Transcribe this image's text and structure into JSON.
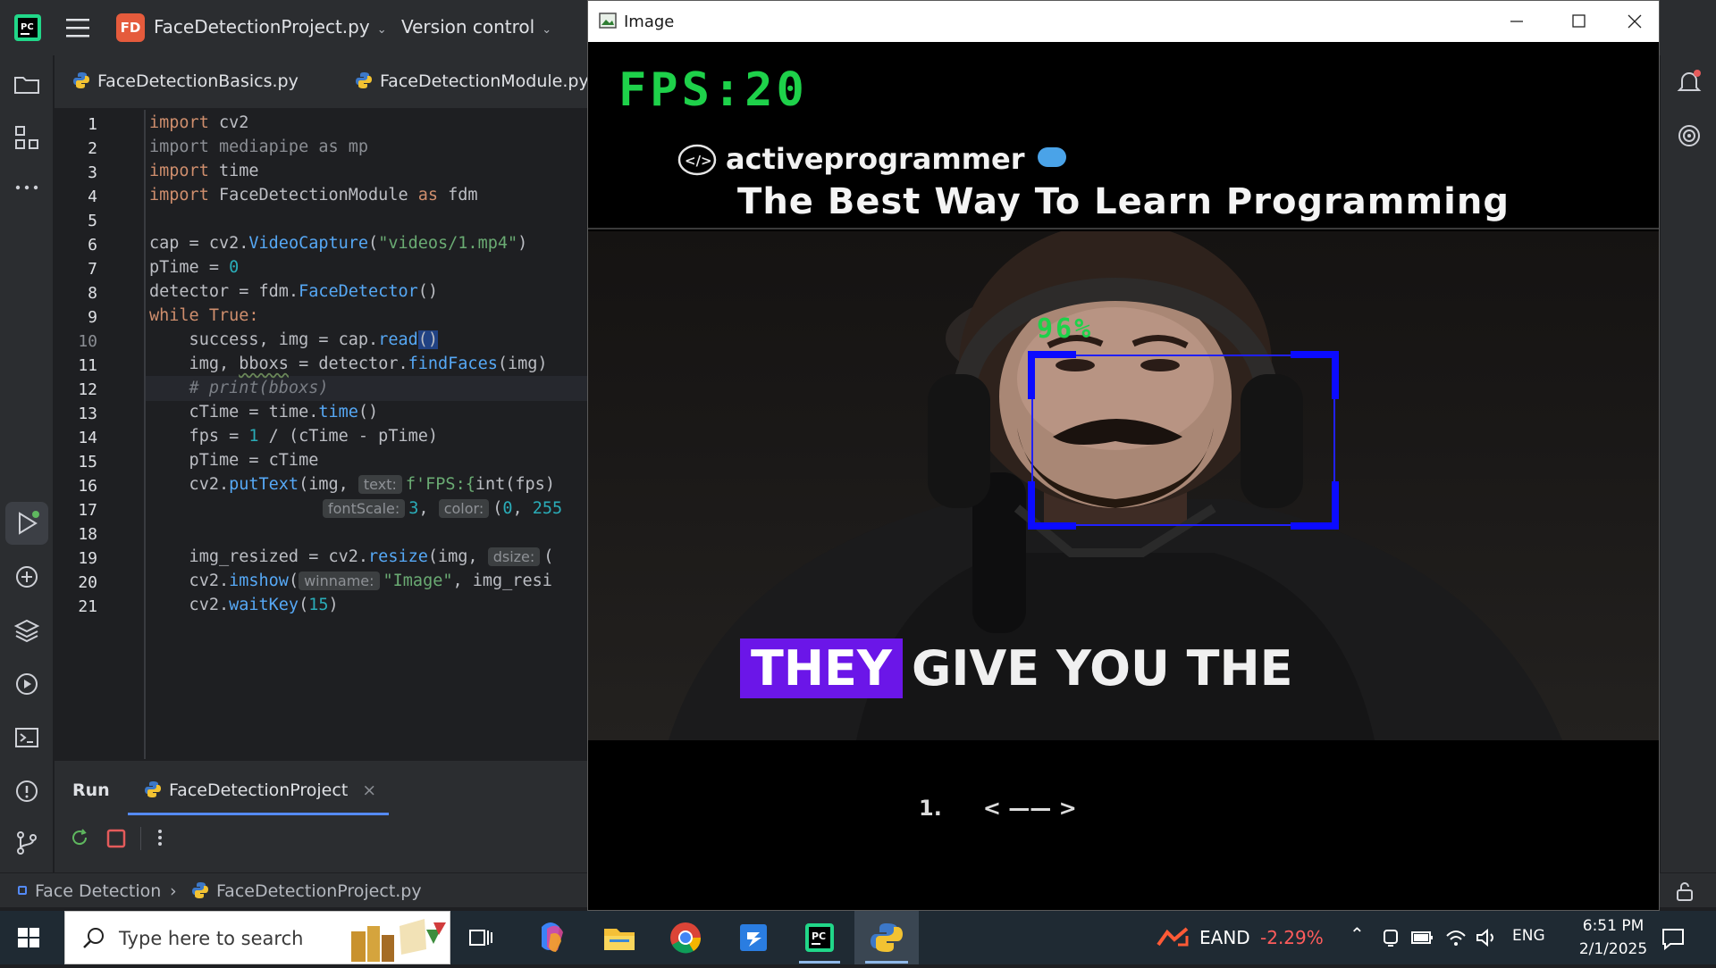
{
  "ide": {
    "project_badge": "FD",
    "project_name": "FaceDetectionProject.py",
    "vcs_label": "Version control",
    "tabs": [
      {
        "label": "FaceDetectionBasics.py"
      },
      {
        "label": "FaceDetectionModule.py"
      }
    ],
    "line_numbers": [
      "1",
      "2",
      "3",
      "4",
      "5",
      "6",
      "7",
      "8",
      "9",
      "10",
      "11",
      "12",
      "13",
      "14",
      "15",
      "16",
      "17",
      "18",
      "19",
      "20",
      "21"
    ],
    "code": {
      "l1a": "import",
      "l1b": " cv2",
      "l2": "import mediapipe as mp",
      "l3a": "import",
      "l3b": " time",
      "l4a": "import",
      "l4b": " FaceDetectionModule ",
      "l4c": "as",
      "l4d": " fdm",
      "l6a": "cap = cv2.",
      "l6b": "VideoCapture",
      "l6c": "(",
      "l6d": "\"videos/1.mp4\"",
      "l6e": ")",
      "l7a": "pTime = ",
      "l7b": "0",
      "l8a": "detector = fdm.",
      "l8b": "FaceDetector",
      "l8c": "()",
      "l9a": "while",
      "l9b": " True:",
      "l10a": "    success, img = cap.",
      "l10b": "read",
      "l10c": "()",
      "l11a": "    img, ",
      "l11b": "bboxs",
      "l11c": " = detector.",
      "l11d": "findFaces",
      "l11e": "(img)",
      "l12": "    # print(bboxs)",
      "l13a": "    cTime = time.",
      "l13b": "time",
      "l13c": "()",
      "l14a": "    fps = ",
      "l14b": "1",
      "l14c": " / (cTime - pTime)",
      "l15": "    pTime = cTime",
      "l16a": "    cv2.",
      "l16b": "putText",
      "l16c": "(img, ",
      "l16hint": "text:",
      "l16d": "f'FPS:{",
      "l16e": "int",
      "l16f": "(fps)",
      "l17hint1": "fontScale:",
      "l17a": "3",
      "l17b": ", ",
      "l17hint2": "color:",
      "l17c": "(",
      "l17d": "0",
      "l17e": ", ",
      "l17f": "255",
      "l19a": "    img_resized = cv2.",
      "l19b": "resize",
      "l19c": "(img, ",
      "l19hint": "dsize:",
      "l19d": "(",
      "l20a": "    cv2.",
      "l20b": "imshow",
      "l20c": "(",
      "l20hint": "winname:",
      "l20d": "\"Image\"",
      "l20e": ", img_resi",
      "l21a": "    cv2.",
      "l21b": "waitKey",
      "l21c": "(",
      "l21d": "15",
      "l21e": ")"
    },
    "run_panel": {
      "label": "Run",
      "tab_label": "FaceDetectionProject"
    },
    "status": {
      "crumb1": "Face Detection",
      "crumb2": "FaceDetectionProject.py"
    }
  },
  "image_window": {
    "title": "Image",
    "fps_text": "FPS:20",
    "brand": "activeprogrammer",
    "tagline": "The Best Way To Learn Programming",
    "confidence": "96%",
    "caption_highlight": "THEY",
    "caption_rest": "GIVE YOU THE",
    "pager_num": "1.",
    "pager_nav": "<  ——  >"
  },
  "taskbar": {
    "search_placeholder": "Type here to search",
    "stock_name": "EAND",
    "stock_change": "-2.29%",
    "lang": "ENG",
    "time": "6:51 PM",
    "date": "2/1/2025"
  },
  "colors": {
    "ide_bg": "#1e1f22",
    "fps_green": "#1ed14a",
    "bbox_blue": "#0b0bff",
    "caption_purple": "#6b16e8",
    "stock_red": "#ff5c5c"
  }
}
